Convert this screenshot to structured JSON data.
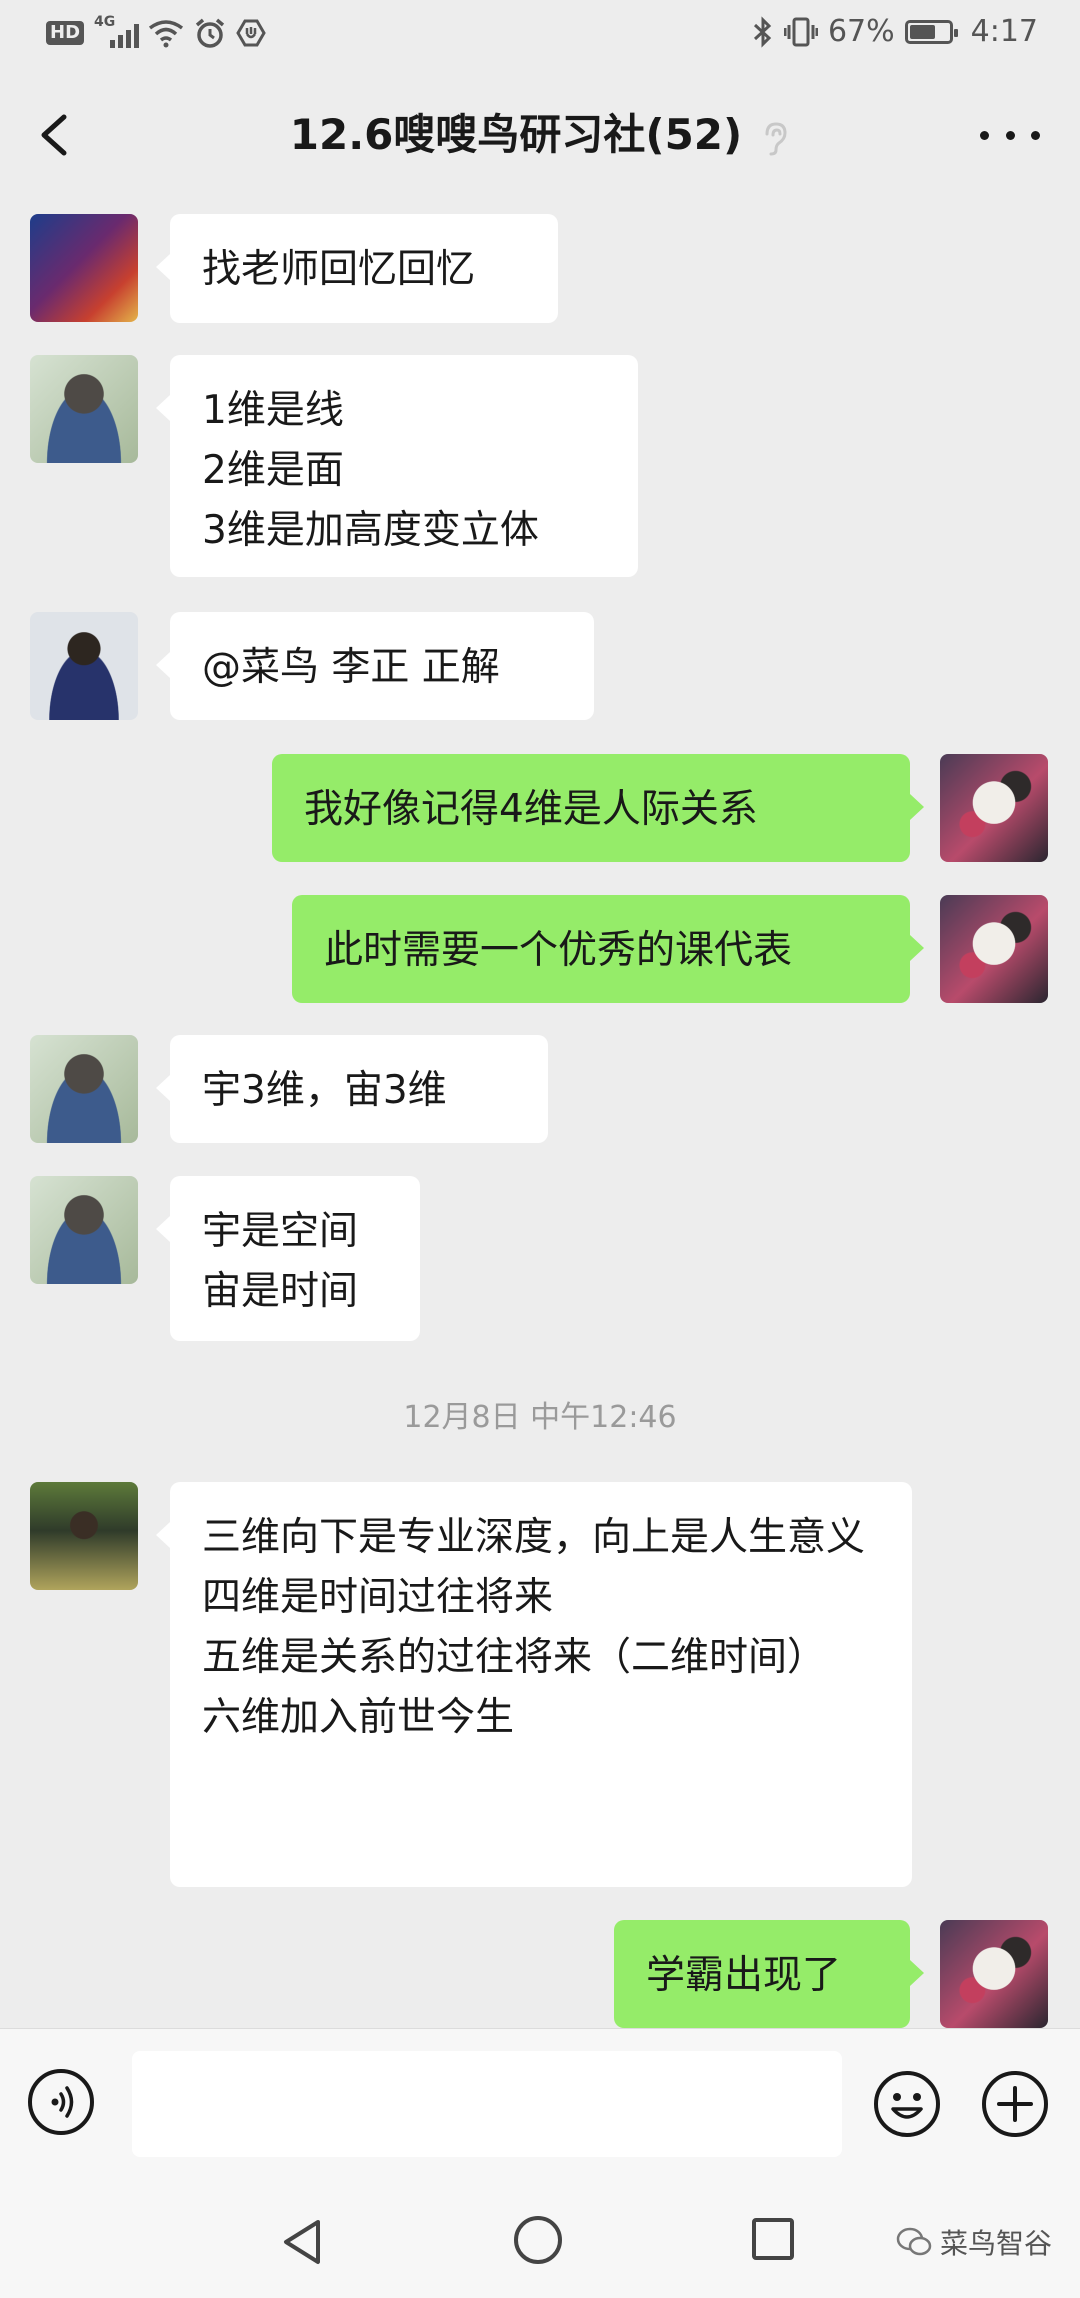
{
  "status_bar": {
    "hd": "HD",
    "network": "4G",
    "battery_percent": "67%",
    "battery_level": 0.67,
    "time": "4:17"
  },
  "header": {
    "title": "12.6嗖嗖鸟研习社(52)"
  },
  "messages": [
    {
      "side": "left",
      "text": "找老师回忆回忆"
    },
    {
      "side": "left",
      "text": "1维是线\n2维是面\n3维是加高度变立体"
    },
    {
      "side": "left",
      "text": "@菜鸟 李正  正解"
    },
    {
      "side": "right",
      "text": "我好像记得4维是人际关系"
    },
    {
      "side": "right",
      "text": "此时需要一个优秀的课代表"
    },
    {
      "side": "left",
      "text": "宇3维，宙3维"
    },
    {
      "side": "left",
      "text": "宇是空间\n宙是时间"
    },
    {
      "side": "left",
      "text": "三维向下是专业深度，向上是人生意义\n四维是时间过往将来\n五维是关系的过往将来（二维时间）\n六维加入前世今生"
    },
    {
      "side": "right",
      "text": "学霸出现了"
    }
  ],
  "timestamp": "12月8日 中午12:46",
  "input_bar": {
    "placeholder": "",
    "icons": [
      "voice-icon",
      "emoji-icon",
      "plus-icon"
    ]
  },
  "nav_bar": {
    "icons": [
      "nav-back-icon",
      "nav-home-icon",
      "nav-recent-icon"
    ]
  },
  "watermark": "菜鸟智谷",
  "colors": {
    "background": "#ededed",
    "bubble_left": "#ffffff",
    "bubble_right": "#95ec69"
  }
}
